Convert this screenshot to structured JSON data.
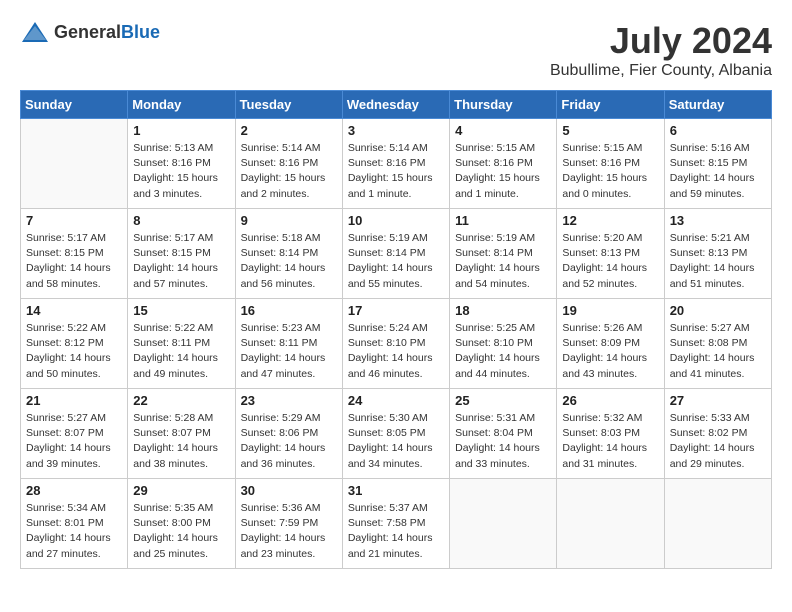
{
  "header": {
    "logo_general": "General",
    "logo_blue": "Blue",
    "month": "July 2024",
    "location": "Bubullime, Fier County, Albania"
  },
  "days_of_week": [
    "Sunday",
    "Monday",
    "Tuesday",
    "Wednesday",
    "Thursday",
    "Friday",
    "Saturday"
  ],
  "weeks": [
    [
      {
        "day": "",
        "info": ""
      },
      {
        "day": "1",
        "info": "Sunrise: 5:13 AM\nSunset: 8:16 PM\nDaylight: 15 hours\nand 3 minutes."
      },
      {
        "day": "2",
        "info": "Sunrise: 5:14 AM\nSunset: 8:16 PM\nDaylight: 15 hours\nand 2 minutes."
      },
      {
        "day": "3",
        "info": "Sunrise: 5:14 AM\nSunset: 8:16 PM\nDaylight: 15 hours\nand 1 minute."
      },
      {
        "day": "4",
        "info": "Sunrise: 5:15 AM\nSunset: 8:16 PM\nDaylight: 15 hours\nand 1 minute."
      },
      {
        "day": "5",
        "info": "Sunrise: 5:15 AM\nSunset: 8:16 PM\nDaylight: 15 hours\nand 0 minutes."
      },
      {
        "day": "6",
        "info": "Sunrise: 5:16 AM\nSunset: 8:15 PM\nDaylight: 14 hours\nand 59 minutes."
      }
    ],
    [
      {
        "day": "7",
        "info": "Sunrise: 5:17 AM\nSunset: 8:15 PM\nDaylight: 14 hours\nand 58 minutes."
      },
      {
        "day": "8",
        "info": "Sunrise: 5:17 AM\nSunset: 8:15 PM\nDaylight: 14 hours\nand 57 minutes."
      },
      {
        "day": "9",
        "info": "Sunrise: 5:18 AM\nSunset: 8:14 PM\nDaylight: 14 hours\nand 56 minutes."
      },
      {
        "day": "10",
        "info": "Sunrise: 5:19 AM\nSunset: 8:14 PM\nDaylight: 14 hours\nand 55 minutes."
      },
      {
        "day": "11",
        "info": "Sunrise: 5:19 AM\nSunset: 8:14 PM\nDaylight: 14 hours\nand 54 minutes."
      },
      {
        "day": "12",
        "info": "Sunrise: 5:20 AM\nSunset: 8:13 PM\nDaylight: 14 hours\nand 52 minutes."
      },
      {
        "day": "13",
        "info": "Sunrise: 5:21 AM\nSunset: 8:13 PM\nDaylight: 14 hours\nand 51 minutes."
      }
    ],
    [
      {
        "day": "14",
        "info": "Sunrise: 5:22 AM\nSunset: 8:12 PM\nDaylight: 14 hours\nand 50 minutes."
      },
      {
        "day": "15",
        "info": "Sunrise: 5:22 AM\nSunset: 8:11 PM\nDaylight: 14 hours\nand 49 minutes."
      },
      {
        "day": "16",
        "info": "Sunrise: 5:23 AM\nSunset: 8:11 PM\nDaylight: 14 hours\nand 47 minutes."
      },
      {
        "day": "17",
        "info": "Sunrise: 5:24 AM\nSunset: 8:10 PM\nDaylight: 14 hours\nand 46 minutes."
      },
      {
        "day": "18",
        "info": "Sunrise: 5:25 AM\nSunset: 8:10 PM\nDaylight: 14 hours\nand 44 minutes."
      },
      {
        "day": "19",
        "info": "Sunrise: 5:26 AM\nSunset: 8:09 PM\nDaylight: 14 hours\nand 43 minutes."
      },
      {
        "day": "20",
        "info": "Sunrise: 5:27 AM\nSunset: 8:08 PM\nDaylight: 14 hours\nand 41 minutes."
      }
    ],
    [
      {
        "day": "21",
        "info": "Sunrise: 5:27 AM\nSunset: 8:07 PM\nDaylight: 14 hours\nand 39 minutes."
      },
      {
        "day": "22",
        "info": "Sunrise: 5:28 AM\nSunset: 8:07 PM\nDaylight: 14 hours\nand 38 minutes."
      },
      {
        "day": "23",
        "info": "Sunrise: 5:29 AM\nSunset: 8:06 PM\nDaylight: 14 hours\nand 36 minutes."
      },
      {
        "day": "24",
        "info": "Sunrise: 5:30 AM\nSunset: 8:05 PM\nDaylight: 14 hours\nand 34 minutes."
      },
      {
        "day": "25",
        "info": "Sunrise: 5:31 AM\nSunset: 8:04 PM\nDaylight: 14 hours\nand 33 minutes."
      },
      {
        "day": "26",
        "info": "Sunrise: 5:32 AM\nSunset: 8:03 PM\nDaylight: 14 hours\nand 31 minutes."
      },
      {
        "day": "27",
        "info": "Sunrise: 5:33 AM\nSunset: 8:02 PM\nDaylight: 14 hours\nand 29 minutes."
      }
    ],
    [
      {
        "day": "28",
        "info": "Sunrise: 5:34 AM\nSunset: 8:01 PM\nDaylight: 14 hours\nand 27 minutes."
      },
      {
        "day": "29",
        "info": "Sunrise: 5:35 AM\nSunset: 8:00 PM\nDaylight: 14 hours\nand 25 minutes."
      },
      {
        "day": "30",
        "info": "Sunrise: 5:36 AM\nSunset: 7:59 PM\nDaylight: 14 hours\nand 23 minutes."
      },
      {
        "day": "31",
        "info": "Sunrise: 5:37 AM\nSunset: 7:58 PM\nDaylight: 14 hours\nand 21 minutes."
      },
      {
        "day": "",
        "info": ""
      },
      {
        "day": "",
        "info": ""
      },
      {
        "day": "",
        "info": ""
      }
    ]
  ]
}
